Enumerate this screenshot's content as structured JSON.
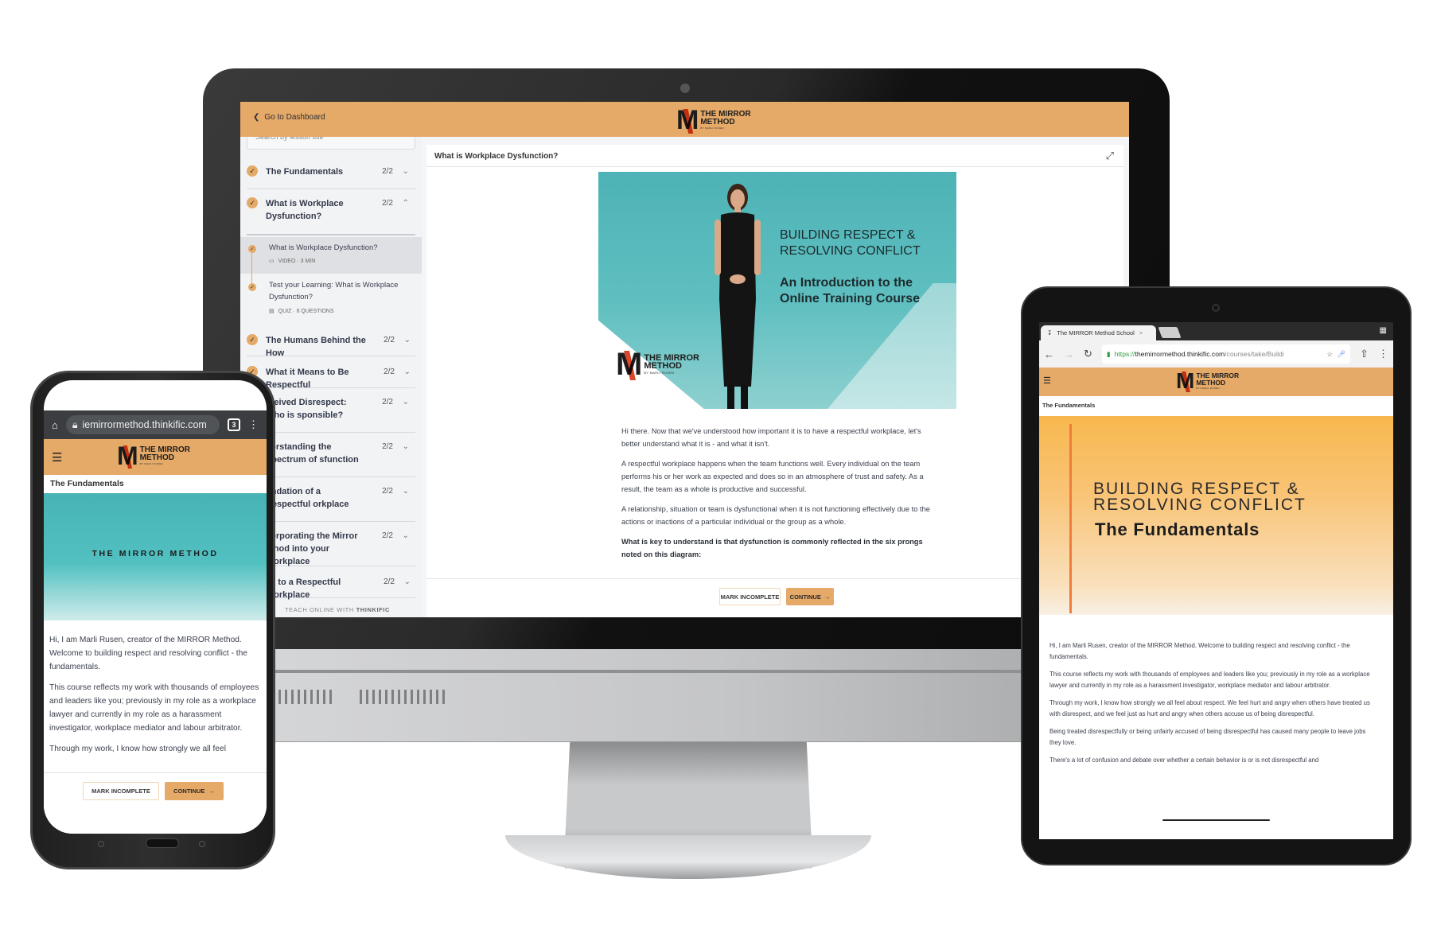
{
  "brand": {
    "name_line1": "THE MIRROR",
    "name_line2": "METHOD",
    "byline": "BY MARLI RUSEN",
    "logo_letter": "M",
    "colors": {
      "header": "#e5a968",
      "accent_red": "#d9472b",
      "teal": "#4eb3b6",
      "orange_banner": "#f8b84e"
    }
  },
  "desktop": {
    "back_link": "Go to Dashboard",
    "search_placeholder": "Search by lesson title",
    "chapters": [
      {
        "title": "The Fundamentals",
        "progress": "2/2",
        "expanded": false,
        "completed": true
      },
      {
        "title": "What is Workplace Dysfunction?",
        "progress": "2/2",
        "expanded": true,
        "completed": true
      },
      {
        "title": "The Humans Behind the How",
        "progress": "2/2",
        "expanded": false,
        "completed": true
      },
      {
        "title": "What it Means to Be Respectful",
        "progress": "2/2",
        "expanded": false,
        "completed": true
      },
      {
        "title": "Perceived Disrespect: Who is Responsible?",
        "progress": "2/2",
        "expanded": false,
        "completed": true
      },
      {
        "title": "Understanding the Spectrum of Dysfunction",
        "progress": "2/2",
        "expanded": false,
        "completed": true
      },
      {
        "title": "Foundation of a Respectful Workplace",
        "progress": "2/2",
        "expanded": false,
        "completed": true
      },
      {
        "title": "Incorporating the Mirror Method into your Workplace",
        "progress": "2/2",
        "expanded": false,
        "completed": true
      },
      {
        "title": "Keys to a Respectful Workplace",
        "progress": "2/2",
        "expanded": false,
        "completed": true
      }
    ],
    "visible_chapter_titles": [
      "The Fundamentals",
      "What is Workplace Dysfunction?",
      "The Humans Behind the How",
      "What it Means to Be Respectful",
      "rceived Disrespect: Who is sponsible?",
      "derstanding the Spectrum of sfunction",
      "undation of a Respectful orkplace",
      "corporating the Mirror ethod into your Workplace",
      "ys to a Respectful Workplace"
    ],
    "lessons": [
      {
        "title": "What is Workplace Dysfunction?",
        "meta": "VIDEO · 3 MIN",
        "type_icon": "video-icon",
        "active": true,
        "completed": true
      },
      {
        "title": "Test your Learning: What is Workplace Dysfunction?",
        "meta": "QUIZ · 6 QUESTIONS",
        "type_icon": "quiz-icon",
        "active": false,
        "completed": true
      }
    ],
    "footer_prefix": "TEACH ONLINE WITH",
    "footer_brand": "THINKIFIC",
    "lesson_title": "What is Workplace Dysfunction?",
    "video": {
      "title_line1": "BUILDING RESPECT &",
      "title_line2": "RESOLVING CONFLICT",
      "subtitle_line1": "An Introduction to the",
      "subtitle_line2": "Online Training Course"
    },
    "paragraphs": [
      "Hi there. Now that we've understood how important it is to have a respectful workplace, let's better understand what it is - and what it isn't.",
      "A respectful workplace happens when the team functions well. Every individual on the team performs his or her work as expected and does so in an atmosphere of trust and safety. As a result, the team as a whole is productive and successful.",
      "A relationship, situation or team is dysfunctional when it is not functioning effectively due to the actions or inactions of a particular individual or the group as a whole.",
      "What is key to understand is that dysfunction is commonly reflected in the six prongs noted on this diagram:"
    ],
    "mark_incomplete": "MARK INCOMPLETE",
    "continue": "CONTINUE"
  },
  "phone": {
    "url": "iemirrormethod.thinkific.com",
    "tab_count": "3",
    "course_title": "The Fundamentals",
    "banner_text": "THE MIRROR METHOD",
    "paragraphs": [
      "Hi, I am Marli Rusen, creator of the MIRROR Method. Welcome to building respect and resolving conflict - the fundamentals.",
      "This course reflects my work with thousands of employees and leaders like you; previously in my role as a workplace lawyer and currently in my role as a harassment investigator, workplace mediator and labour arbitrator.",
      "Through my work, I know how strongly we all feel"
    ],
    "mark_incomplete": "MARK INCOMPLETE",
    "continue": "CONTINUE"
  },
  "tablet": {
    "tab_title": "The MIRROR Method School",
    "url_scheme": "https://",
    "url_host": "themirrormethod.thinkific.com",
    "url_path": "/courses/take/Buildi",
    "course_title": "The Fundamentals",
    "banner_line1": "BUILDING RESPECT &",
    "banner_line2": "RESOLVING CONFLICT",
    "banner_subtitle": "The Fundamentals",
    "paragraphs": [
      "Hi, I am Marli Rusen, creator of the MIRROR Method. Welcome to building respect and resolving conflict - the fundamentals.",
      "This course reflects my work with thousands of employees and leaders like you; previously in my role as a workplace lawyer and currently in my role as a harassment investigator, workplace mediator and labour arbitrator.",
      "Through my work, I know how strongly we all feel about respect. We feel hurt and angry when others have treated us with disrespect, and we feel just as hurt and angry when others accuse us of being disrespectful.",
      "Being treated disrespectfully or being unfairly accused of being disrespectful has caused many people to leave jobs they love.",
      "There's a lot of confusion and debate over whether a certain behavior is or is not disrespectful and"
    ]
  }
}
